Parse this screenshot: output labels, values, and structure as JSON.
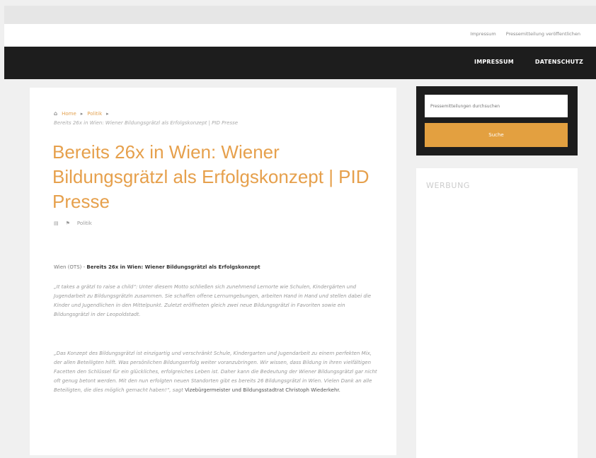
{
  "utility_links": [
    "Impressum",
    "Pressemitteilung veröffentlichen"
  ],
  "nav": [
    "IMPRESSUM",
    "DATENSCHUTZ"
  ],
  "breadcrumb": {
    "home": "Home",
    "category": "Politik",
    "current": "Bereits 26x in Wien: Wiener Bildungsgrätzl als Erfolgskonzept | PID Presse"
  },
  "article": {
    "title": "Bereits 26x in Wien: Wiener Bildungsgrätzl als Erfolgskonzept | PID Presse",
    "meta_category": "Politik",
    "lead_prefix": "Wien (OTS) - ",
    "lead_bold": "Bereits 26x in Wien: Wiener Bildungsgrätzl als Erfolgskonzept",
    "paragraph_1": "„It takes a grätzl to raise a child“: Unter diesem Motto schließen sich zunehmend Lernorte wie Schulen, Kindergärten und Jugendarbeit zu Bildungsgrätzln zusammen. Sie schaffen offene Lernumgebungen, arbeiten Hand in Hand und stellen dabei die Kinder und Jugendlichen in den Mittelpunkt. Zuletzt eröffneten gleich zwei neue Bildungsgrätzl in Favoriten sowie ein Bildungsgrätzl in der Leopoldstadt.",
    "paragraph_2": "„Das Konzept des Bildungsgrätzl ist einzigartig und verschränkt Schule, Kindergarten und Jugendarbeit zu einem perfekten Mix, der allen Beteiligten hilft. Was persönlichen Bildungserfolg weiter voranzubringen. Wir wissen, dass Bildung in ihren vielfältigen Facetten den Schlüssel für ein glückliches, erfolgreiches Leben ist. Daher kann die Bedeutung der Wiener Bildungsgrätzl gar nicht oft genug betont werden. Mit den nun erfolgten neuen Standorten gibt es bereits 26 Bildungsgrätzl in Wien. Vielen Dank an alle Beteiligten, die dies möglich gemacht haben!“, sagt ",
    "paragraph_2_emph": "Vizebürgermeister und Bildungsstadtrat Christoph Wiederkehr."
  },
  "sidebar": {
    "search_placeholder": "Pressemitteilungen durchsuchen",
    "search_button": "Suche",
    "ad_label": "WERBUNG"
  }
}
